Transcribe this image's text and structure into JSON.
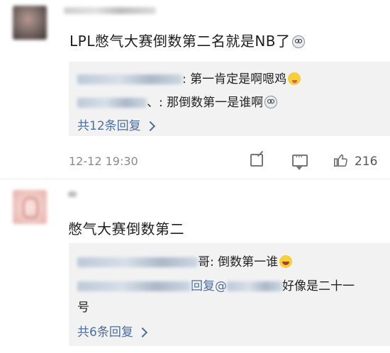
{
  "comments": [
    {
      "text": "LPL憋气大赛倒数第二名就是NB了",
      "emoji": "dizzy-face-icon",
      "replies": [
        {
          "text": ": 第一肯定是啊嗯鸡",
          "emoji": "tongue-face-icon"
        },
        {
          "text": "、: 那倒数第一是谁啊",
          "emoji": "dizzy-face-icon"
        }
      ],
      "more_label": "共12条回复",
      "time": "12-12 19:30",
      "like_count": "216"
    },
    {
      "text": "憋气大赛倒数第二",
      "replies": [
        {
          "text": "哥: 倒数第一谁",
          "emoji": "laughing-face-icon"
        },
        {
          "text_a": "回复@",
          "text_b": "好像是二十一",
          "text_c": "号"
        }
      ],
      "more_label": "共6条回复"
    }
  ],
  "colors": {
    "link": "#4a6fa0",
    "panel": "#f2f2f2",
    "meta": "#8a8a8a"
  }
}
